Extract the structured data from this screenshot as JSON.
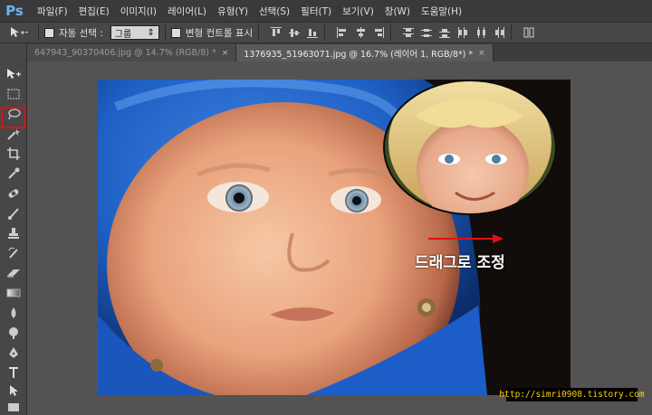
{
  "app": {
    "logo": "Ps"
  },
  "menu": {
    "items": [
      "파일(F)",
      "편집(E)",
      "이미지(I)",
      "레이어(L)",
      "유형(Y)",
      "선택(S)",
      "필터(T)",
      "보기(V)",
      "창(W)",
      "도움말(H)"
    ]
  },
  "options": {
    "tool_icon": "move-tool-icon",
    "auto_select_label": "자동 선택 :",
    "auto_select_value": "그룹",
    "transform_controls_label": "변형 컨트롤 표시"
  },
  "tabs": [
    {
      "label": "647943_90370406.jpg @ 14.7% (RGB/8) *",
      "active": false
    },
    {
      "label": "1376935_51963071.jpg @ 16.7% (레이어 1, RGB/8*) *",
      "active": true
    }
  ],
  "tab_close_glyph": "×",
  "annotation": {
    "drag_label": "드래그로 조정",
    "url": "http://simri0908.tistory.com",
    "highlight_color": "#e01010"
  },
  "tools": [
    "move-tool-icon",
    "marquee-tool-icon",
    "lasso-tool-icon",
    "magic-wand-tool-icon",
    "crop-tool-icon",
    "eyedropper-tool-icon",
    "healing-brush-tool-icon",
    "brush-tool-icon",
    "clone-stamp-tool-icon",
    "history-brush-tool-icon",
    "eraser-tool-icon",
    "gradient-tool-icon",
    "blur-tool-icon",
    "dodge-tool-icon",
    "pen-tool-icon",
    "type-tool-icon",
    "path-selection-tool-icon",
    "rectangle-tool-icon"
  ]
}
